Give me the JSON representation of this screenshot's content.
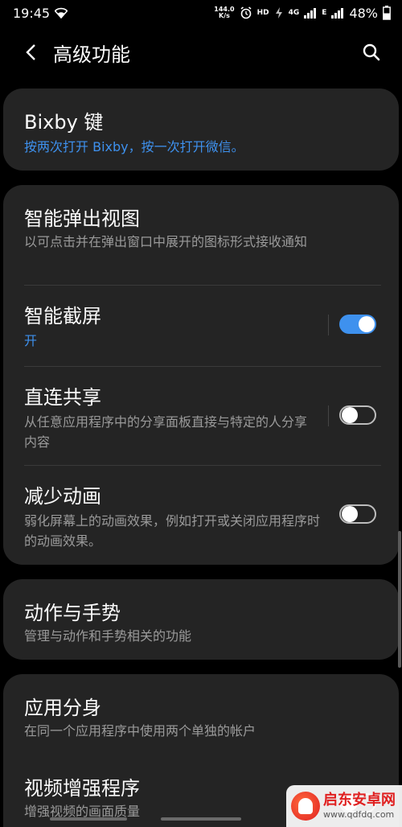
{
  "status_bar": {
    "time": "19:45",
    "net_speed_value": "144.0",
    "net_speed_unit": "K/s",
    "hd_label": "HD",
    "lte_label": "4G",
    "e_label": "E",
    "battery_text": "48%"
  },
  "header": {
    "title": "高级功能"
  },
  "items": {
    "bixby": {
      "title": "Bixby 键",
      "subtitle": "按两次打开 Bixby，按一次打开微信。"
    },
    "smart_popup": {
      "title": "智能弹出视图",
      "subtitle": "以可点击并在弹出窗口中展开的图标形式接收通知"
    },
    "smart_capture": {
      "title": "智能截屏",
      "subtitle": "开",
      "enabled": true
    },
    "direct_share": {
      "title": "直连共享",
      "subtitle": "从任意应用程序中的分享面板直接与特定的人分享内容",
      "enabled": false
    },
    "reduce_animations": {
      "title": "减少动画",
      "subtitle": "弱化屏幕上的动画效果，例如打开或关闭应用程序时的动画效果。",
      "enabled": false
    },
    "motions": {
      "title": "动作与手势",
      "subtitle": "管理与动作和手势相关的功能"
    },
    "dual_messenger": {
      "title": "应用分身",
      "subtitle": "在同一个应用程序中使用两个单独的帐户"
    },
    "video_enhancer": {
      "title": "视频增强程序",
      "subtitle": "增强视频的画面质量"
    }
  },
  "watermark": {
    "name": "启东安卓网",
    "url": "www.qdfdq.com"
  },
  "colors": {
    "background": "#000000",
    "card": "#242424",
    "accent": "#3e91ee",
    "secondary_text": "#9a9a9a"
  }
}
